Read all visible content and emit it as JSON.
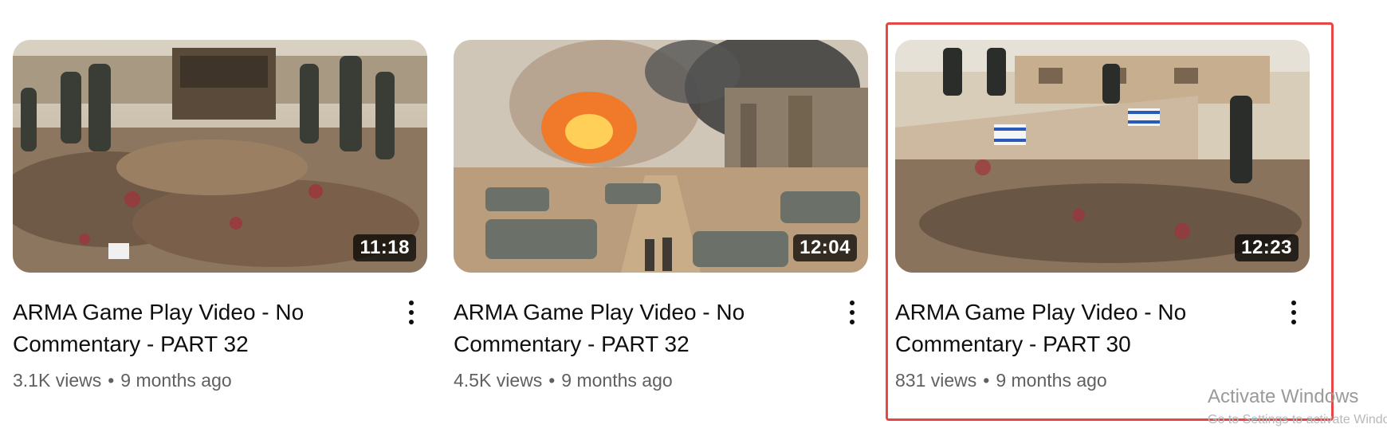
{
  "videos": [
    {
      "title": "ARMA Game Play Video - No Commentary - PART 32",
      "duration": "11:18",
      "views": "3.1K views",
      "age": "9 months ago",
      "thumbnail_icon": "soldiers-desert-thumbnail"
    },
    {
      "title": "ARMA Game Play Video - No Commentary - PART 32",
      "duration": "12:04",
      "views": "4.5K views",
      "age": "9 months ago",
      "thumbnail_icon": "tanks-explosion-thumbnail"
    },
    {
      "title": "ARMA Game Play Video - No Commentary - PART 30",
      "duration": "12:23",
      "views": "831 views",
      "age": "9 months ago",
      "thumbnail_icon": "ruined-compound-thumbnail"
    }
  ],
  "separator": "•",
  "watermark": {
    "title": "Activate Windows",
    "subtitle": "Go to Settings to activate Windows."
  },
  "colors": {
    "highlight": "#e84545",
    "title_text": "#0f0f0f",
    "meta_text": "#606060"
  }
}
